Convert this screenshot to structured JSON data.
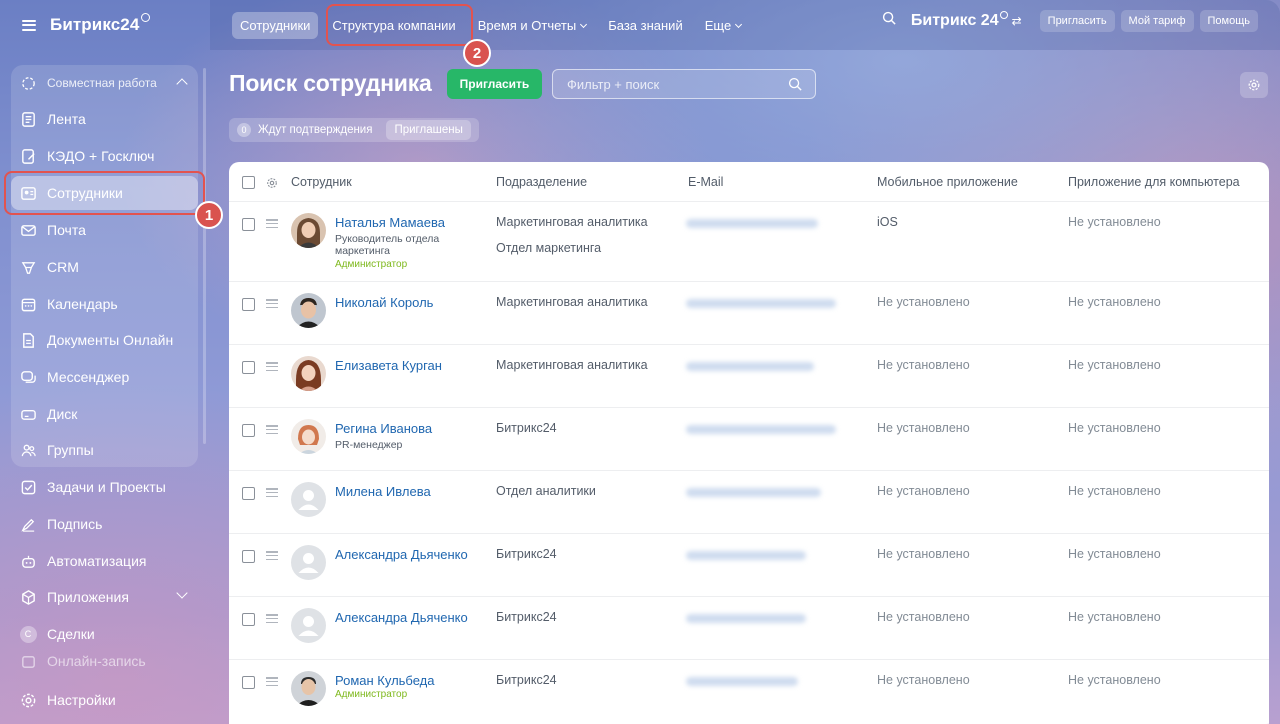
{
  "sidebar": {
    "logo": "Битрикс24",
    "group_label": "Совместная работа",
    "items": [
      {
        "label": "Лента",
        "icon": "feed-icon"
      },
      {
        "label": "КЭДО + Госключ",
        "icon": "document-sign-icon"
      },
      {
        "label": "Сотрудники",
        "icon": "employees-icon"
      },
      {
        "label": "Почта",
        "icon": "mail-icon"
      },
      {
        "label": "CRM",
        "icon": "crm-icon"
      },
      {
        "label": "Календарь",
        "icon": "calendar-icon"
      },
      {
        "label": "Документы Онлайн",
        "icon": "documents-icon"
      },
      {
        "label": "Мессенджер",
        "icon": "messenger-icon"
      },
      {
        "label": "Диск",
        "icon": "disk-icon"
      },
      {
        "label": "Группы",
        "icon": "groups-icon"
      },
      {
        "label": "Задачи и Проекты",
        "icon": "tasks-icon"
      },
      {
        "label": "Подпись",
        "icon": "signature-icon"
      },
      {
        "label": "Автоматизация",
        "icon": "automation-icon"
      },
      {
        "label": "Приложения",
        "icon": "apps-icon"
      },
      {
        "label": "Сделки",
        "icon": "deals-icon",
        "letter": "С"
      },
      {
        "label": "Настройки",
        "icon": "settings-icon"
      }
    ],
    "hidden_partial": "Онлайн-запись"
  },
  "topbar": {
    "nav": [
      {
        "label": "Сотрудники",
        "active": true
      },
      {
        "label": "Структура компании"
      },
      {
        "label": "Время и Отчеты",
        "dropdown": true
      },
      {
        "label": "База знаний"
      },
      {
        "label": "Еще",
        "dropdown": true
      }
    ],
    "brand": "Битрикс 24",
    "invite": "Пригласить",
    "tariff": "Мой тариф",
    "help": "Помощь"
  },
  "page": {
    "title": "Поиск сотрудника",
    "invite_button": "Пригласить",
    "filter_placeholder": "Фильтр + поиск",
    "tabs": [
      {
        "label": "Ждут подтверждения",
        "count": "0"
      },
      {
        "label": "Приглашены"
      }
    ]
  },
  "callouts": {
    "one": "1",
    "two": "2"
  },
  "table": {
    "columns": [
      "Сотрудник",
      "Подразделение",
      "E-Mail",
      "Мобильное приложение",
      "Приложение для компьютера"
    ],
    "rows": [
      {
        "name": "Наталья Мамаева",
        "position": "Руководитель отдела маркетинга",
        "role": "Администратор",
        "dept": "Маркетинговая аналитика",
        "dept2": "Отдел маркетинга",
        "mobile": "iOS",
        "desktop": "Не установлено"
      },
      {
        "name": "Николай Король",
        "dept": "Маркетинговая аналитика",
        "mobile": "Не установлено",
        "desktop": "Не установлено"
      },
      {
        "name": "Елизавета Курган",
        "dept": "Маркетинговая аналитика",
        "mobile": "Не установлено",
        "desktop": "Не установлено"
      },
      {
        "name": "Регина Иванова",
        "position": "PR-менеджер",
        "dept": "Битрикс24",
        "mobile": "Не установлено",
        "desktop": "Не установлено"
      },
      {
        "name": "Милена Ивлева",
        "dept": "Отдел аналитики",
        "mobile": "Не установлено",
        "desktop": "Не установлено"
      },
      {
        "name": "Александра Дьяченко",
        "dept": "Битрикс24",
        "mobile": "Не установлено",
        "desktop": "Не установлено"
      },
      {
        "name": "Александра Дьяченко",
        "dept": "Битрикс24",
        "mobile": "Не установлено",
        "desktop": "Не установлено"
      },
      {
        "name": "Роман Кульбеда",
        "role": "Администратор",
        "dept": "Битрикс24",
        "mobile": "Не установлено",
        "desktop": "Не установлено"
      }
    ]
  },
  "colors": {
    "accent_green": "#27b768",
    "link_blue": "#2067b0",
    "highlight_red": "#e2534f",
    "admin_green": "#7fb91e"
  }
}
